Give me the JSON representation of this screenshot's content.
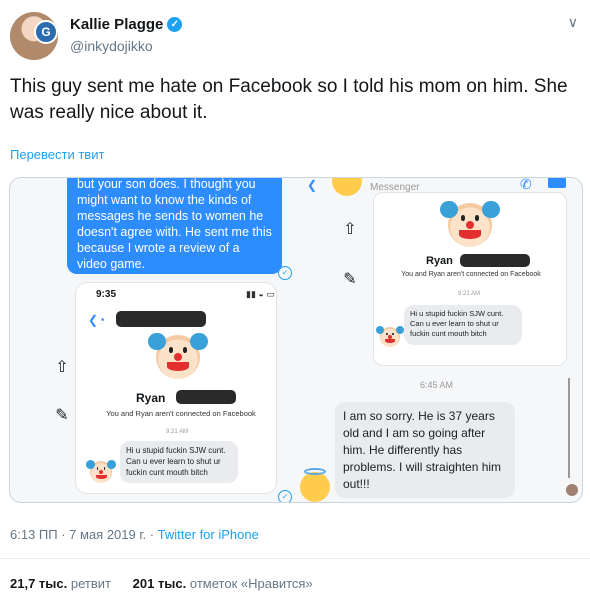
{
  "author": {
    "name": "Kallie Plagge",
    "handle": "@inkydojikko",
    "avatar_badge": "G"
  },
  "tweet": {
    "text": "This guy sent me hate on Facebook so I told his mom on him. She was really nice about it.",
    "translate_label": "Перевести твит"
  },
  "media": {
    "left_message": "but your son does. I thought you might want to know the kinds of messages he sends to women he doesn't agree with. He sent me this because I wrote a review of a video game.",
    "phone_time": "9:35",
    "profile_name": "Ryan",
    "not_connected": "You and Ryan aren't connected on Facebook",
    "msg_time": "9:21 AM",
    "hate_message": "Hi u stupid fuckin SJW cunt. Can u ever learn to shut ur fuckin cunt mouth bitch",
    "messenger_label": "Messenger",
    "reply_time": "6:45 AM",
    "mom_reply": "I am so sorry. He is 37 years old and I am so going after him. He differently has problems. I will straighten him out!!!"
  },
  "meta": {
    "timestamp": "6:13 ПП · 7 мая 2019 г. · ",
    "source": "Twitter for iPhone"
  },
  "stats": {
    "retweets": "21,7 тыс.",
    "retweets_label": "ретвит",
    "likes": "201 тыс.",
    "likes_label": "отметок «Нравится»"
  }
}
